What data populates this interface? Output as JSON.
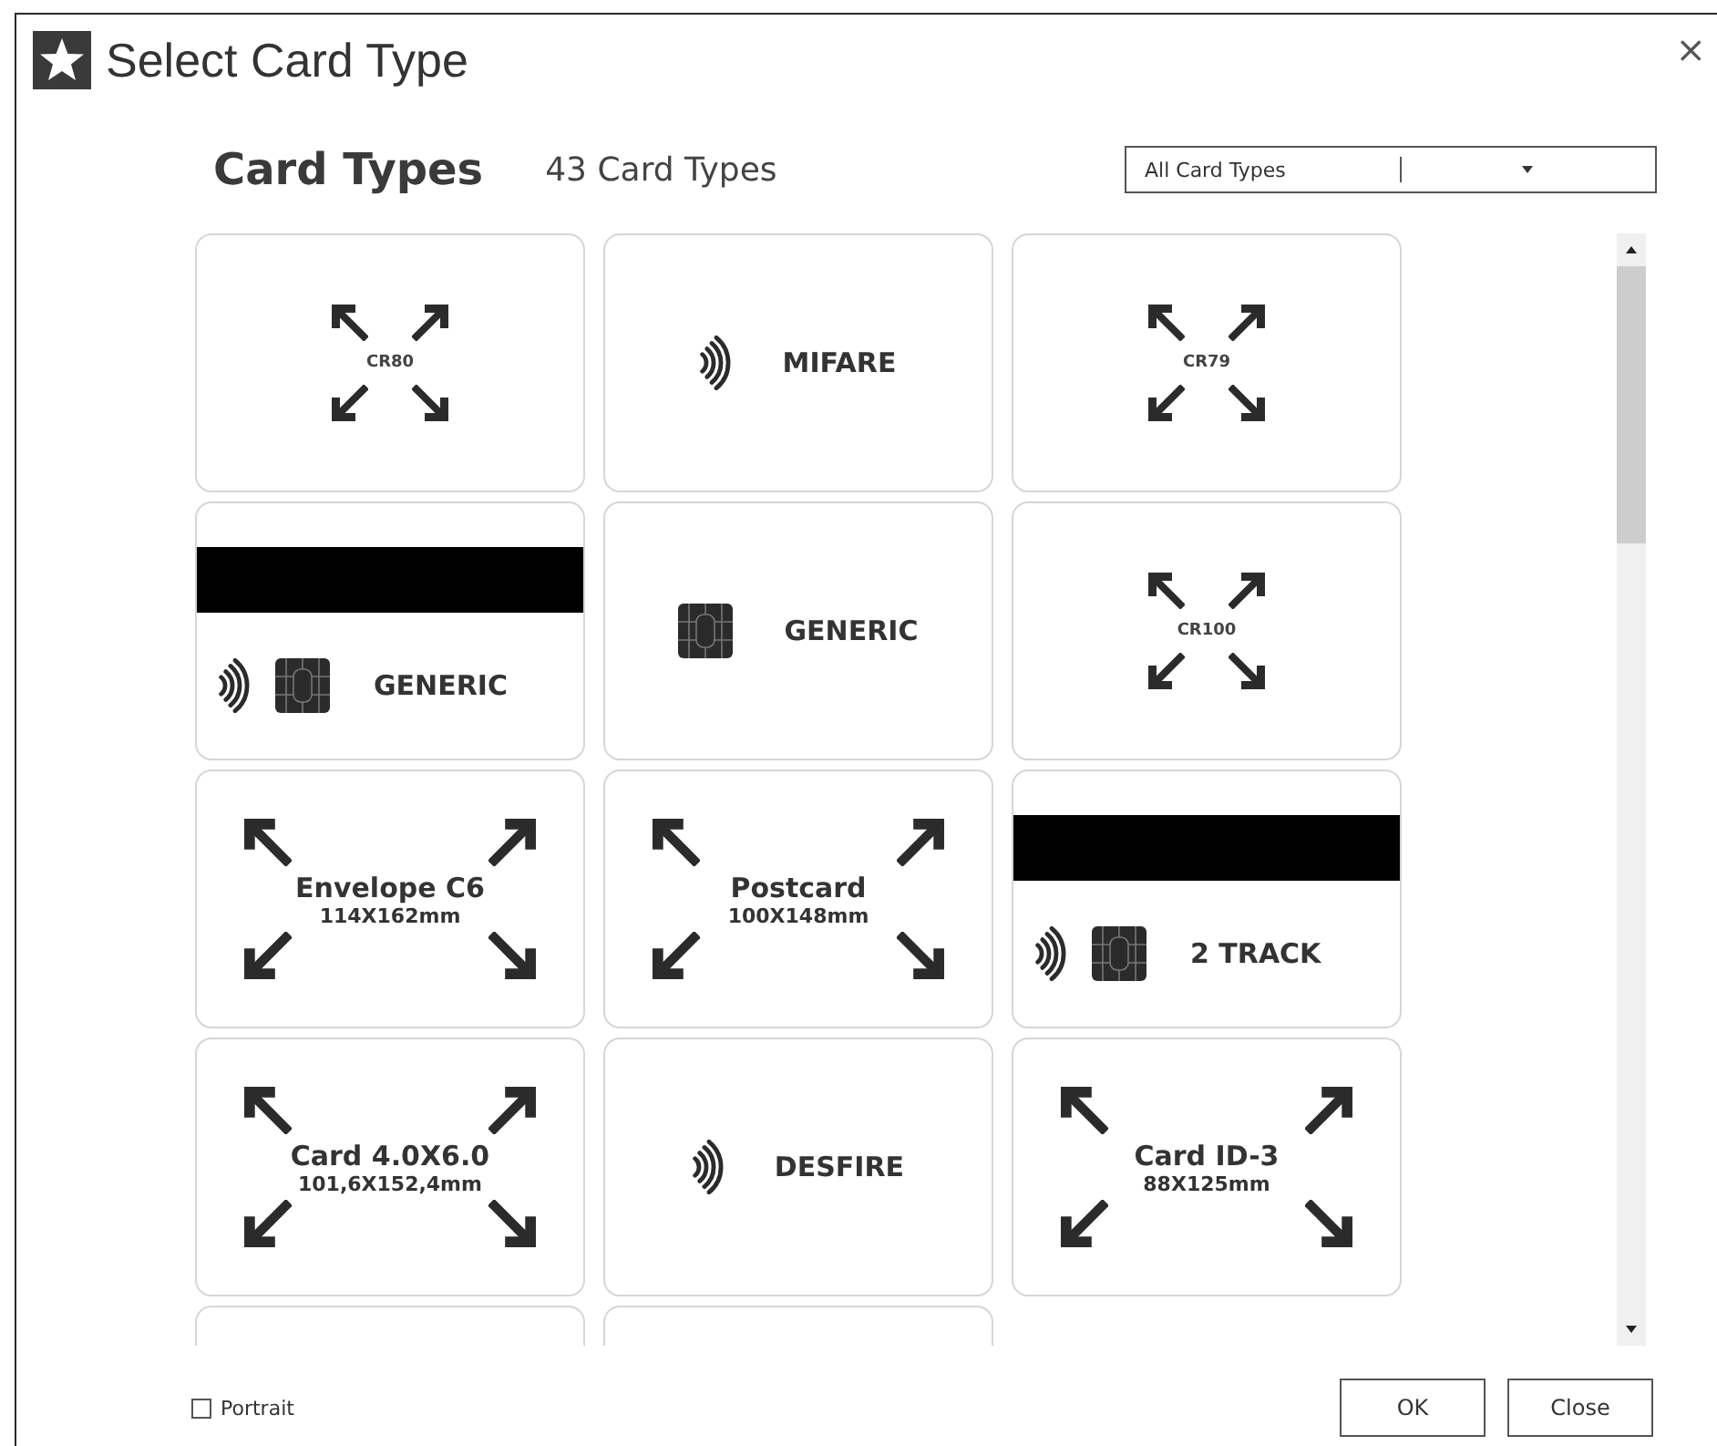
{
  "window": {
    "title": "Select Card Type",
    "close": "×"
  },
  "header": {
    "title": "Card Types",
    "count": "43 Card Types",
    "filter": {
      "value": "All Card Types"
    }
  },
  "cards": [
    {
      "kind": "format",
      "label": "CR80"
    },
    {
      "kind": "tech",
      "magstripe": false,
      "contactless": true,
      "chip": false,
      "label": "MIFARE"
    },
    {
      "kind": "format",
      "label": "CR79"
    },
    {
      "kind": "tech",
      "magstripe": true,
      "contactless": true,
      "chip": true,
      "label": "GENERIC"
    },
    {
      "kind": "tech",
      "magstripe": false,
      "contactless": false,
      "chip": true,
      "label": "GENERIC"
    },
    {
      "kind": "format",
      "label": "CR100"
    },
    {
      "kind": "page",
      "label": "Envelope C6",
      "dims": "114X162mm"
    },
    {
      "kind": "page",
      "label": "Postcard",
      "dims": "100X148mm"
    },
    {
      "kind": "tech",
      "magstripe": true,
      "contactless": true,
      "chip": true,
      "label": "2 TRACK"
    },
    {
      "kind": "page",
      "label": "Card 4.0X6.0",
      "dims": "101,6X152,4mm"
    },
    {
      "kind": "tech",
      "magstripe": false,
      "contactless": true,
      "chip": false,
      "label": "DESFIRE"
    },
    {
      "kind": "page",
      "label": "Card ID-3",
      "dims": "88X125mm"
    }
  ],
  "portrait": {
    "label": "Portrait",
    "checked": false
  },
  "buttons": [
    "OK",
    "Close"
  ]
}
